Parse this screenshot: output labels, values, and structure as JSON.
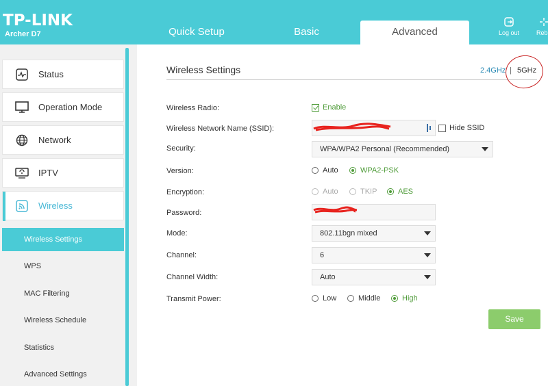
{
  "header": {
    "brand": "TP-LINK",
    "model": "Archer D7",
    "tabs": [
      {
        "label": "Quick Setup"
      },
      {
        "label": "Basic"
      },
      {
        "label": "Advanced",
        "active": true
      }
    ],
    "logout_label": "Log out",
    "reboot_label": "Reb",
    "bg_color": "#4acbd6"
  },
  "sidebar": {
    "items": [
      {
        "label": "Status",
        "icon": "activity-icon"
      },
      {
        "label": "Operation Mode",
        "icon": "monitor-icon"
      },
      {
        "label": "Network",
        "icon": "globe-icon"
      },
      {
        "label": "IPTV",
        "icon": "tv-icon"
      },
      {
        "label": "Wireless",
        "icon": "wifi-icon",
        "active": true
      }
    ],
    "subitems": [
      {
        "label": "Wireless Settings",
        "active": true
      },
      {
        "label": "WPS"
      },
      {
        "label": "MAC Filtering"
      },
      {
        "label": "Wireless Schedule"
      },
      {
        "label": "Statistics"
      },
      {
        "label": "Advanced Settings"
      }
    ]
  },
  "main": {
    "title": "Wireless Settings",
    "bands": {
      "band_24": "2.4GHz",
      "separator": "|",
      "band_5": "5GHz",
      "active": "5GHz"
    },
    "wireless_radio": {
      "label": "Wireless Radio:",
      "option": "Enable",
      "checked": true
    },
    "ssid": {
      "label": "Wireless Network Name (SSID):",
      "value": "",
      "hide_label": "Hide SSID",
      "hide_checked": false
    },
    "security": {
      "label": "Security:",
      "value": "WPA/WPA2 Personal (Recommended)"
    },
    "version": {
      "label": "Version:",
      "options": [
        "Auto",
        "WPA2-PSK"
      ],
      "selected": "WPA2-PSK"
    },
    "encryption": {
      "label": "Encryption:",
      "options": [
        "Auto",
        "TKIP",
        "AES"
      ],
      "selected": "AES"
    },
    "password": {
      "label": "Password:",
      "value": ""
    },
    "mode": {
      "label": "Mode:",
      "value": "802.11bgn mixed"
    },
    "channel": {
      "label": "Channel:",
      "value": "6"
    },
    "channel_width": {
      "label": "Channel Width:",
      "value": "Auto"
    },
    "transmit_power": {
      "label": "Transmit Power:",
      "options": [
        "Low",
        "Middle",
        "High"
      ],
      "selected": "High"
    },
    "save_label": "Save"
  },
  "colors": {
    "accent": "#4acbd6",
    "selected_green": "#4e9b38",
    "save_button": "#8ccc6c",
    "annotation_red": "#c82020"
  }
}
